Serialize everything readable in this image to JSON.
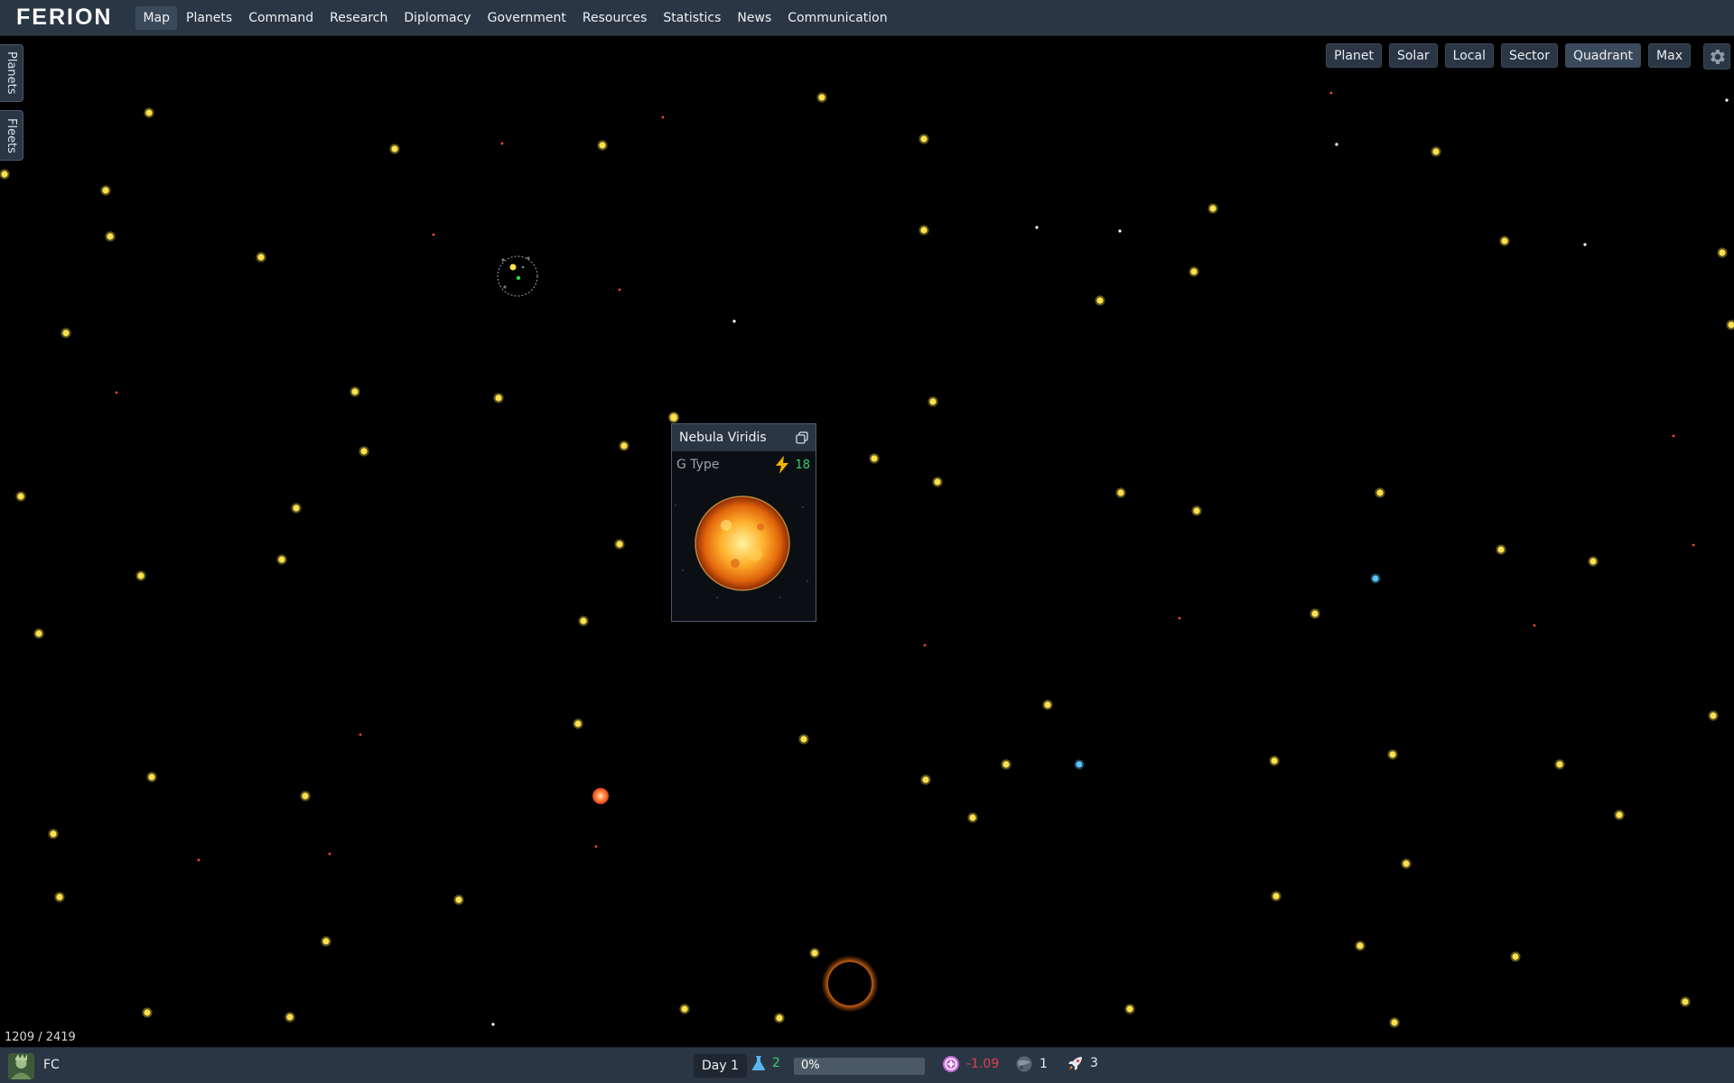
{
  "app": {
    "logo": "FERION"
  },
  "nav": {
    "items": [
      {
        "label": "Map",
        "active": true
      },
      {
        "label": "Planets"
      },
      {
        "label": "Command"
      },
      {
        "label": "Research"
      },
      {
        "label": "Diplomacy"
      },
      {
        "label": "Government"
      },
      {
        "label": "Resources"
      },
      {
        "label": "Statistics"
      },
      {
        "label": "News"
      },
      {
        "label": "Communication"
      }
    ]
  },
  "side_tabs": {
    "planets": "Planets",
    "fleets": "Fleets"
  },
  "zoom": {
    "buttons": [
      "Planet",
      "Solar",
      "Local",
      "Sector",
      "Quadrant",
      "Max"
    ],
    "active": "Quadrant",
    "settings_icon": "gear-icon"
  },
  "map": {
    "coordinates": "1209 / 2419"
  },
  "popup": {
    "title": "Nebula Viridis",
    "copy_icon": "copy-icon",
    "star_type": "G Type",
    "energy_icon": "lightning-icon",
    "energy_value": "18"
  },
  "bottom": {
    "player": "FC",
    "day": "Day 1",
    "research": {
      "icon": "flask-icon",
      "value": "2"
    },
    "progress": {
      "text": "0%",
      "fraction": 0.0
    },
    "influence": {
      "icon": "influence-icon",
      "value": "-1.09"
    },
    "planets": {
      "icon": "planet-icon",
      "value": "1"
    },
    "ships": {
      "icon": "rocket-icon",
      "value": "3"
    }
  },
  "colors": {
    "bar_bg": "#2b3644",
    "accent_blue": "#3b82f6",
    "positive": "#37d16a",
    "negative": "#e0414f",
    "star_yellow": "#ffe14d"
  }
}
